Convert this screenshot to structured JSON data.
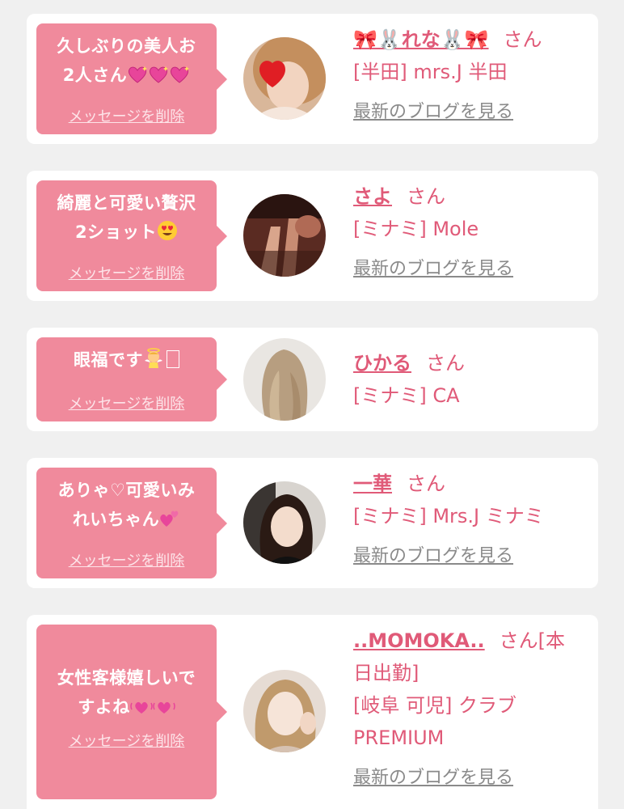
{
  "delete_label": "メッセージを削除",
  "blog_label": "最新のブログを見る",
  "san_label": "さん",
  "colors": {
    "accent": "#f08a9c",
    "link": "#e05a78",
    "muted": "#8a8a8a",
    "card": "#ffffff",
    "background": "#f0f0f0"
  },
  "cards": [
    {
      "message_line1": "久しぶりの美人お",
      "message_line2": "2人さん",
      "message_emojis": [
        "sparkling-heart-icon",
        "sparkling-heart-icon",
        "sparkling-heart-icon"
      ],
      "name": "🎀🐰れな🐰🎀",
      "san": "さん",
      "shop": "[半田] mrs.J 半田"
    },
    {
      "message_line1": "綺麗と可愛い贅沢",
      "message_line2": "2ショット",
      "message_emojis": [
        "heart-eyes-icon"
      ],
      "name": "さよ",
      "san": "さん",
      "shop": "[ミナミ] Mole"
    },
    {
      "message_line1": "眼福です",
      "message_emojis": [
        "baby-angel-icon"
      ],
      "name": "ひかる",
      "san": "さん",
      "shop": "[ミナミ] CA"
    },
    {
      "message_line1": "ありゃ♡可愛いみ",
      "message_line2": "れいちゃん",
      "message_emojis": [
        "two-hearts-icon"
      ],
      "name": "一華",
      "san": "さん",
      "shop": "[ミナミ] Mrs.J ミナミ"
    },
    {
      "message_line1": "女性客様嬉しいで",
      "message_line2": "すよね",
      "message_emojis": [
        "beating-heart-icon",
        "beating-heart-icon"
      ],
      "name": "..MOMOKA..",
      "san": "さん[本",
      "name_suffix_line2": "日出勤]",
      "shop_line1": "[岐阜 可児] クラブ",
      "shop_line2": "PREMIUM"
    }
  ]
}
